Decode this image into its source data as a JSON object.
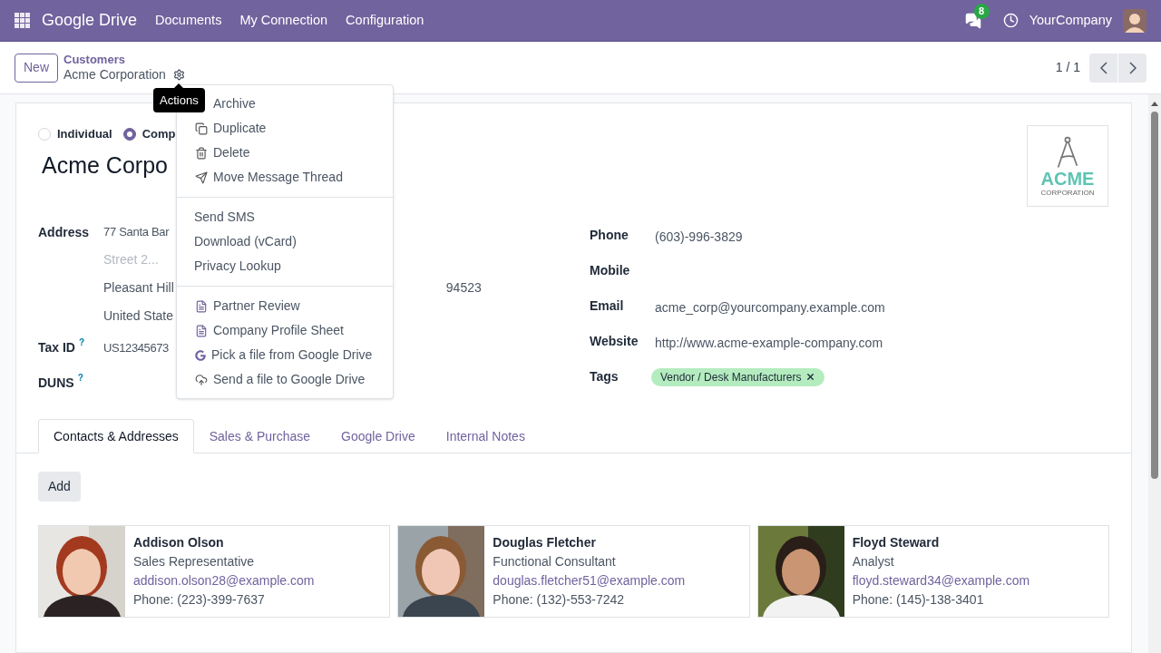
{
  "navbar": {
    "app_name": "Google Drive",
    "menu": [
      "Documents",
      "My Connection",
      "Configuration"
    ],
    "messages_badge": "8",
    "company": "YourCompany"
  },
  "control_panel": {
    "new_button": "New",
    "breadcrumb": "Customers",
    "record_title": "Acme Corporation",
    "tooltip": "Actions",
    "pager": "1 / 1"
  },
  "actions_menu": {
    "sections": [
      [
        {
          "label": "Archive"
        },
        {
          "label": "Duplicate",
          "kind": "copy"
        },
        {
          "label": "Delete",
          "kind": "trash"
        },
        {
          "label": "Move Message Thread",
          "kind": "send"
        }
      ],
      [
        {
          "label": "Send SMS"
        },
        {
          "label": "Download (vCard)"
        },
        {
          "label": "Privacy Lookup"
        }
      ],
      [
        {
          "label": "Partner Review",
          "kind": "document"
        },
        {
          "label": "Company Profile Sheet",
          "kind": "document"
        },
        {
          "label": "Pick a file from Google Drive",
          "kind": "google"
        },
        {
          "label": "Send a file to Google Drive",
          "kind": "upload"
        }
      ]
    ]
  },
  "form": {
    "company_types": [
      {
        "label": "Individual",
        "selected": false
      },
      {
        "label": "Comp",
        "selected": true
      }
    ],
    "name": "Acme Corpo",
    "logo": {
      "name": "ACME",
      "tagline": "CORPORATION"
    },
    "address": {
      "label": "Address",
      "street": "77 Santa Bar",
      "street2_placeholder": "Street 2...",
      "city": "Pleasant Hill",
      "zip": "94523",
      "country": "United State"
    },
    "left_fields": [
      {
        "label": "Tax ID",
        "help": "?",
        "value": "US12345673"
      },
      {
        "label": "DUNS",
        "help": "?"
      }
    ],
    "right_fields": [
      {
        "label": "Phone",
        "value": "(603)-996-3829"
      },
      {
        "label": "Mobile"
      },
      {
        "label": "Email",
        "value": "acme_corp@yourcompany.example.com"
      },
      {
        "label": "Website",
        "value": "http://www.acme-example-company.com"
      }
    ],
    "tags_label": "Tags",
    "tags": [
      {
        "label": "Vendor / Desk Manufacturers"
      }
    ]
  },
  "tabs": [
    {
      "label": "Contacts & Addresses",
      "selected": true
    },
    {
      "label": "Sales & Purchase",
      "selected": false
    },
    {
      "label": "Google Drive",
      "selected": false
    },
    {
      "label": "Internal Notes",
      "selected": false
    }
  ],
  "add_button": "Add",
  "contacts": [
    {
      "name": "Addison Olson",
      "role": "Sales Representative",
      "email": "addison.olson28@example.com",
      "phone": "Phone: (223)-399-7637"
    },
    {
      "name": "Douglas Fletcher",
      "role": "Functional Consultant",
      "email": "douglas.fletcher51@example.com",
      "phone": "Phone: (132)-553-7242"
    },
    {
      "name": "Floyd Steward",
      "role": "Analyst",
      "email": "floyd.steward34@example.com",
      "phone": "Phone: (145)-138-3401"
    }
  ]
}
